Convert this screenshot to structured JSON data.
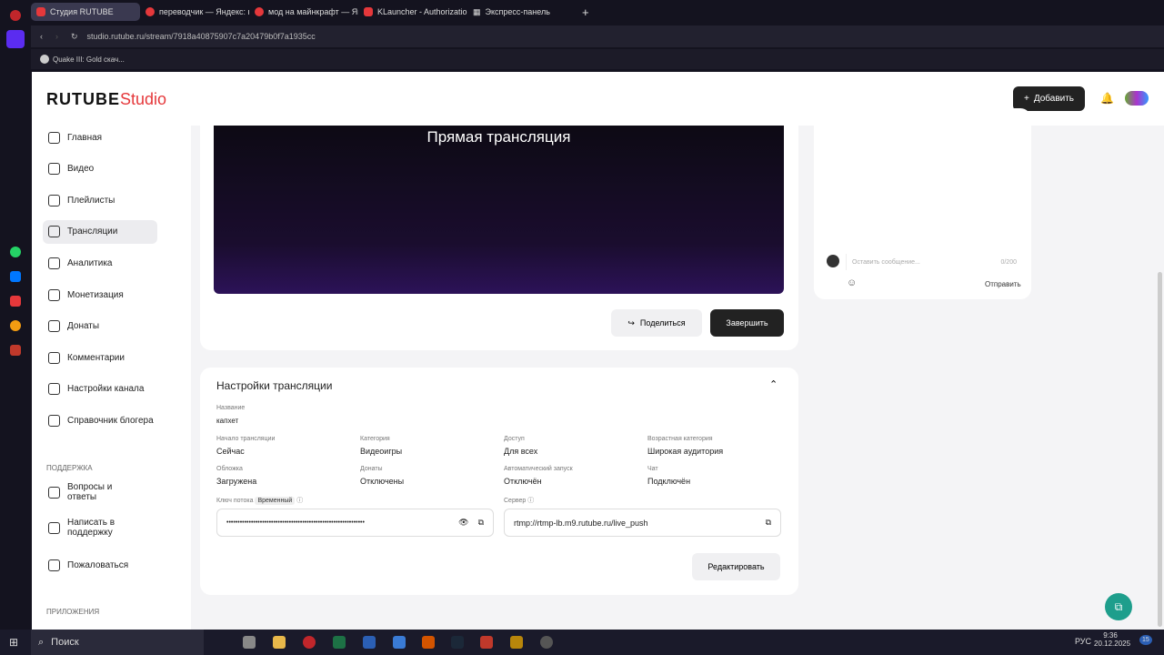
{
  "browser": {
    "tabs": [
      {
        "label": "Студия RUTUBE",
        "active": true
      },
      {
        "label": "переводчик — Яндекс: н"
      },
      {
        "label": "мод на майнкрафт — Ян"
      },
      {
        "label": "KLauncher - Authorization"
      },
      {
        "label": "Экспресс-панель"
      }
    ],
    "url": "studio.rutube.ru/stream/7918a40875907c7a20479b0f7a1935cc",
    "bookmark": "Quake III: Gold скач..."
  },
  "app": {
    "logo": "RUTUBE",
    "logo_suffix": "Studio",
    "add_label": "Добавить",
    "nav": [
      "Главная",
      "Видео",
      "Плейлисты",
      "Трансляции",
      "Аналитика",
      "Монетизация",
      "Донаты",
      "Комментарии",
      "Настройки канала",
      "Справочник блогера"
    ],
    "support_title": "ПОДДЕРЖКА",
    "support": [
      "Вопросы и ответы",
      "Написать в поддержку",
      "Пожаловаться"
    ],
    "apps_title": "ПРИЛОЖЕНИЯ"
  },
  "stream": {
    "video_title": "Прямая трансляция",
    "share_label": "Поделиться",
    "finish_label": "Завершить",
    "settings_title": "Настройки трансляции",
    "name_label": "Название",
    "name_value": "капхет",
    "fields": [
      {
        "label": "Начало трансляции",
        "value": "Сейчас"
      },
      {
        "label": "Категория",
        "value": "Видеоигры"
      },
      {
        "label": "Доступ",
        "value": "Для всех"
      },
      {
        "label": "Возрастная категория",
        "value": "Широкая аудитория"
      },
      {
        "label": "Обложка",
        "value": "Загружена"
      },
      {
        "label": "Донаты",
        "value": "Отключены"
      },
      {
        "label": "Автоматический запуск",
        "value": "Отключён"
      },
      {
        "label": "Чат",
        "value": "Подключён"
      }
    ],
    "key_label": "Ключ потока",
    "key_badge": "Временный",
    "key_value": "••••••••••••••••••••••••••••••••••••••••••••••••••••••••••••••",
    "server_label": "Сервер",
    "server_value": "rtmp://rtmp-lb.m9.rutube.ru/live_push",
    "edit_label": "Редактировать"
  },
  "chat": {
    "placeholder": "Оставить сообщение...",
    "counter": "0/200",
    "send_label": "Отправить"
  },
  "taskbar": {
    "search": "Поиск",
    "lang": "РУС",
    "time": "9:36",
    "date": "20.12.2025",
    "notifications": "15"
  }
}
